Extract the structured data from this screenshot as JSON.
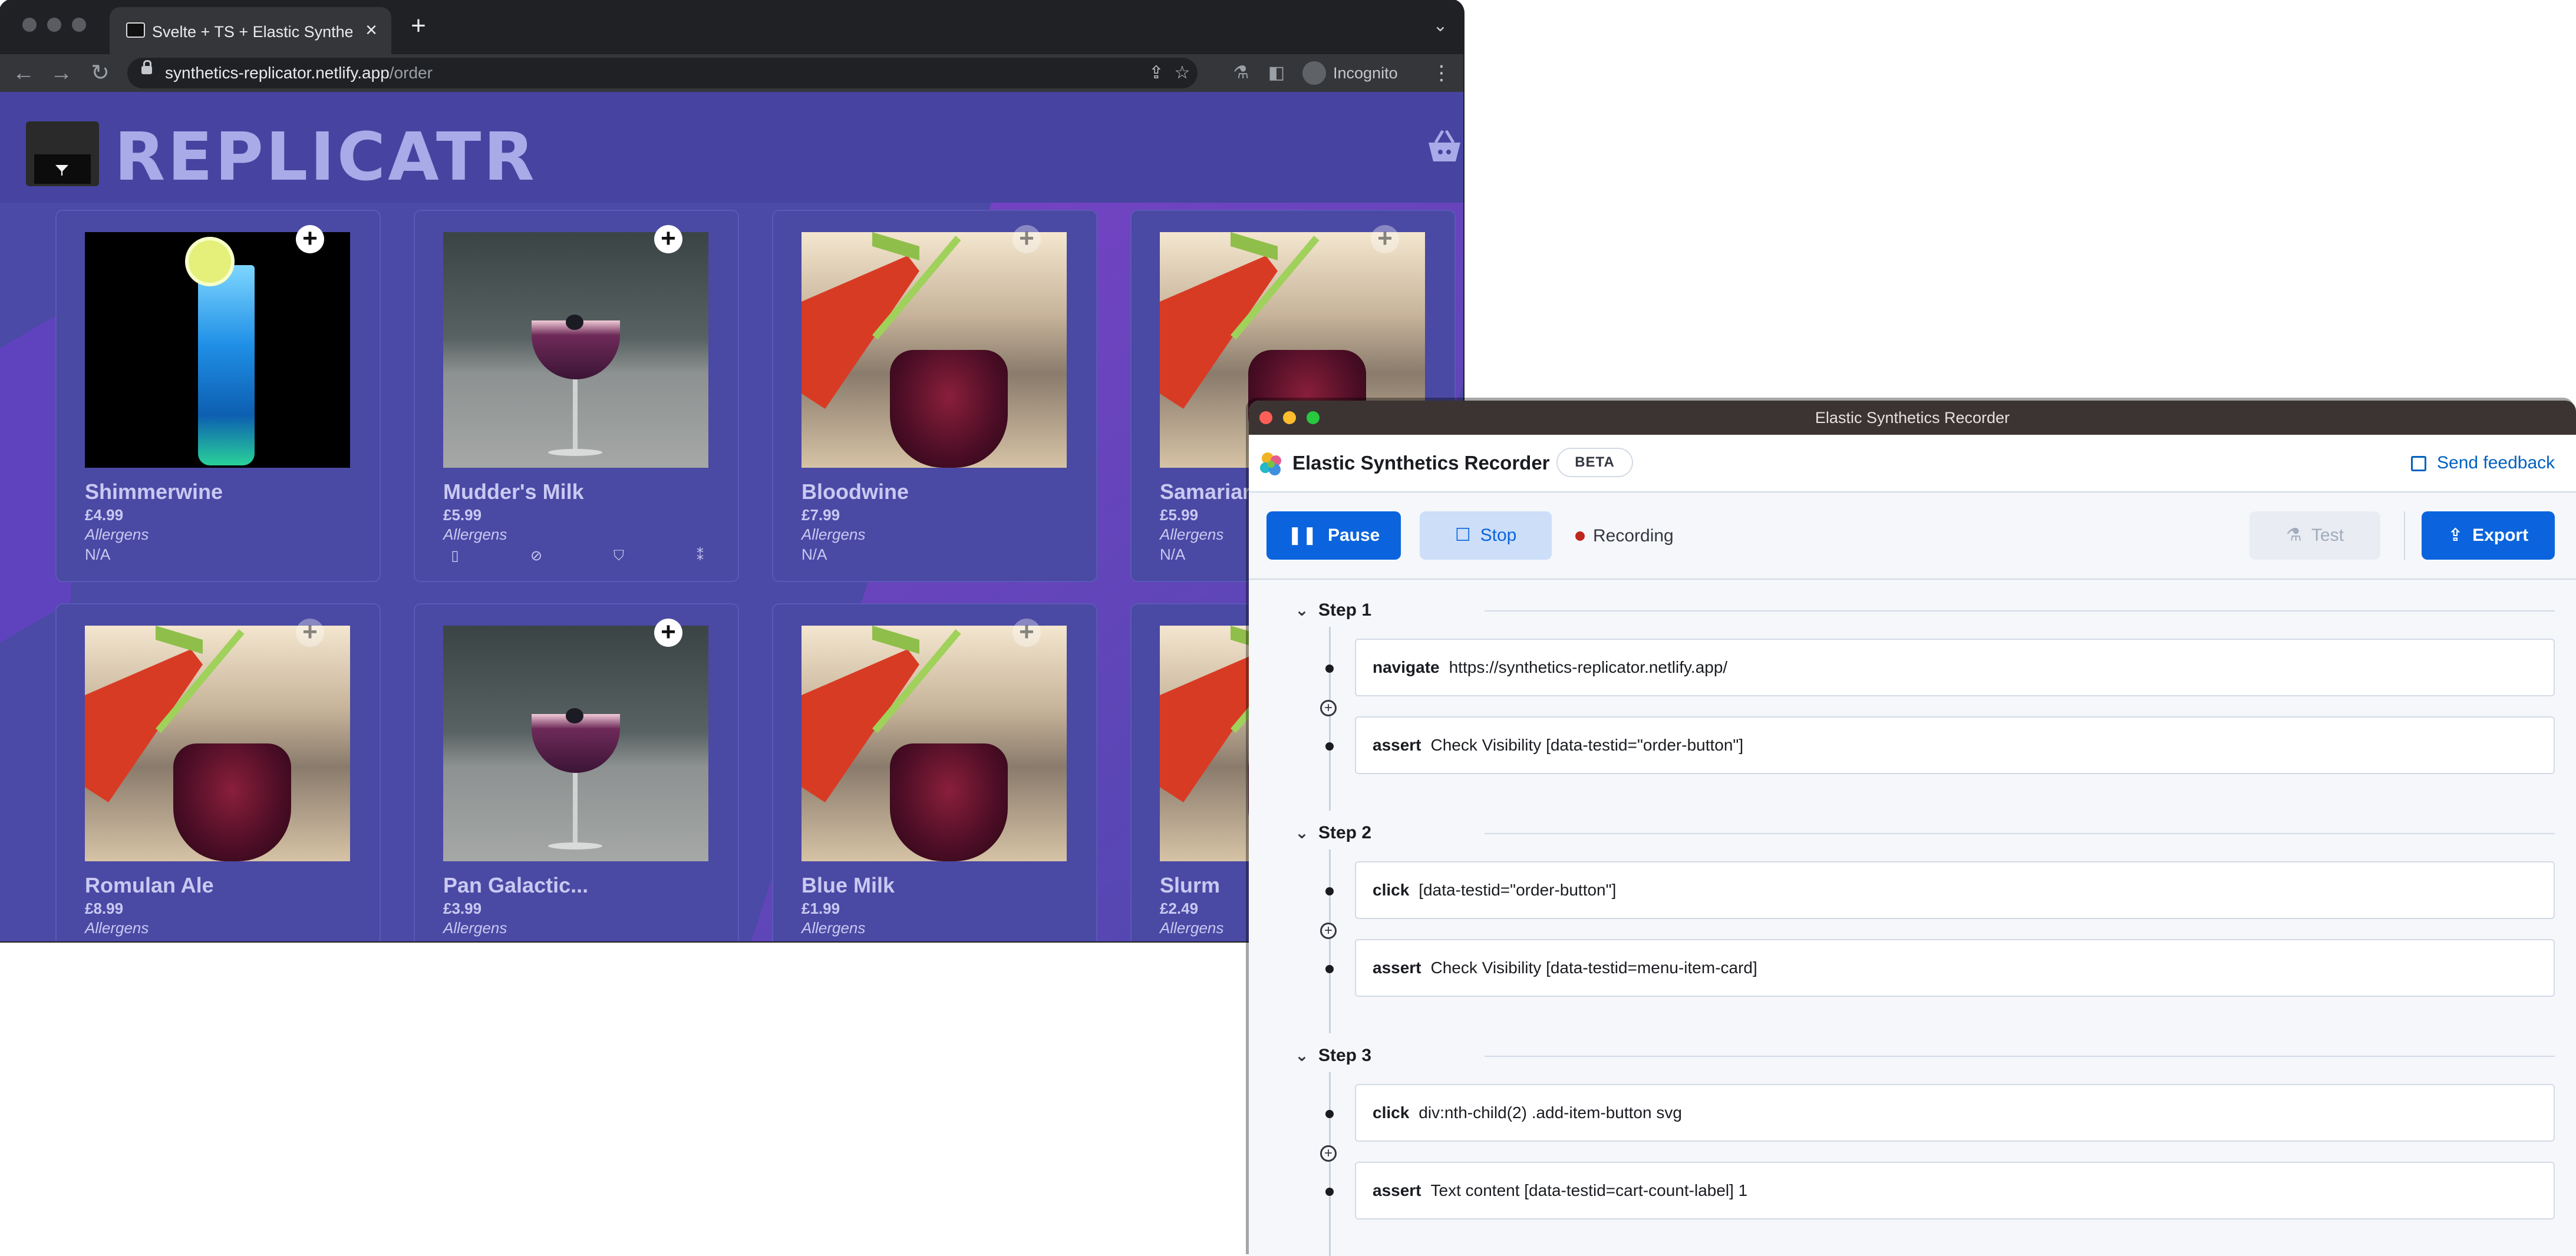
{
  "browser": {
    "tab_title": "Svelte + TS + Elastic Synthetic",
    "url_host": "synthetics-replicator.netlify.app",
    "url_path": "/order",
    "profile_label": "Incognito",
    "icons": {
      "back": "back-arrow-icon",
      "forward": "forward-arrow-icon",
      "reload": "reload-icon",
      "share": "share-icon",
      "bookmark": "star-icon",
      "extension": "flask-icon",
      "sidepanel": "sidepanel-icon",
      "menu": "kebab-icon"
    }
  },
  "site": {
    "logo_text": "REPLICATR",
    "cart_icon": "basket-icon",
    "menu_items": [
      {
        "name": "Shimmerwine",
        "price": "£4.99",
        "allergens_label": "Allergens",
        "allergens_value": "N/A"
      },
      {
        "name": "Mudder's Milk",
        "price": "£5.99",
        "allergens_label": "Allergens",
        "allergen_icons": [
          "bottle-icon",
          "link-icon",
          "shell-icon",
          "wheat-icon"
        ]
      },
      {
        "name": "Bloodwine",
        "price": "£7.99",
        "allergens_label": "Allergens",
        "allergens_value": "N/A"
      },
      {
        "name": "Samarian",
        "price": "£5.99",
        "allergens_label": "Allergens",
        "allergens_value": "N/A"
      },
      {
        "name": "Romulan Ale",
        "price": "£8.99",
        "allergens_label": "Allergens"
      },
      {
        "name": "Pan Galactic...",
        "price": "£3.99",
        "allergens_label": "Allergens"
      },
      {
        "name": "Blue Milk",
        "price": "£1.99",
        "allergens_label": "Allergens"
      },
      {
        "name": "Slurm",
        "price": "£2.49",
        "allergens_label": "Allergens"
      }
    ]
  },
  "recorder": {
    "window_title": "Elastic Synthetics Recorder",
    "app_name": "Elastic Synthetics Recorder",
    "badge": "BETA",
    "feedback_label": "Send feedback",
    "pause_label": "Pause",
    "stop_label": "Stop",
    "status_label": "Recording",
    "test_label": "Test",
    "export_label": "Export",
    "status_color": "#bd271e",
    "accent_color": "#0b64dd",
    "steps": [
      {
        "title": "Step 1",
        "actions": [
          {
            "verb": "navigate",
            "detail": "https://synthetics-replicator.netlify.app/"
          },
          {
            "verb": "assert",
            "detail": "Check Visibility [data-testid=\"order-button\"]"
          }
        ]
      },
      {
        "title": "Step 2",
        "actions": [
          {
            "verb": "click",
            "detail": "[data-testid=\"order-button\"]"
          },
          {
            "verb": "assert",
            "detail": "Check Visibility [data-testid=menu-item-card]"
          }
        ]
      },
      {
        "title": "Step 3",
        "actions": [
          {
            "verb": "click",
            "detail": "div:nth-child(2) .add-item-button svg"
          },
          {
            "verb": "assert",
            "detail": "Text content [data-testid=cart-count-label] 1"
          }
        ]
      }
    ]
  }
}
